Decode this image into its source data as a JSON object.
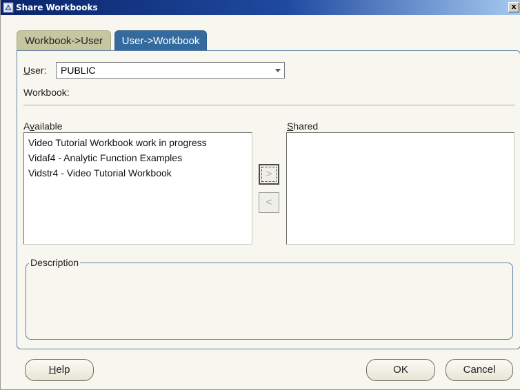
{
  "window": {
    "title": "Share Workbooks",
    "close_label": "x"
  },
  "tabs": [
    {
      "label": "Workbook->User",
      "active": false
    },
    {
      "label": "User->Workbook",
      "active": true
    }
  ],
  "user": {
    "label_accel": "U",
    "label_rest": "ser:",
    "value": "PUBLIC"
  },
  "workbook": {
    "label": "Workbook:"
  },
  "available": {
    "label_pre": "A",
    "label_accel": "v",
    "label_post": "ailable",
    "items": [
      "Video Tutorial Workbook work in progress",
      "Vidaf4 - Analytic Function Examples",
      "Vidstr4 - Video Tutorial Workbook"
    ]
  },
  "shared": {
    "label_accel": "S",
    "label_rest": "hared",
    "items": []
  },
  "move_buttons": {
    "right_glyph": ">",
    "left_glyph": "<"
  },
  "description": {
    "label": "Description"
  },
  "buttons": {
    "help_accel": "H",
    "help_rest": "elp",
    "ok": "OK",
    "cancel": "Cancel"
  },
  "colors": {
    "titlebar_start": "#0a246a",
    "active_tab": "#356a9e",
    "inactive_tab": "#c7c6a0",
    "dialog_bg": "#f7f7ef"
  },
  "icons": {
    "title": "share-workbook-icon"
  }
}
